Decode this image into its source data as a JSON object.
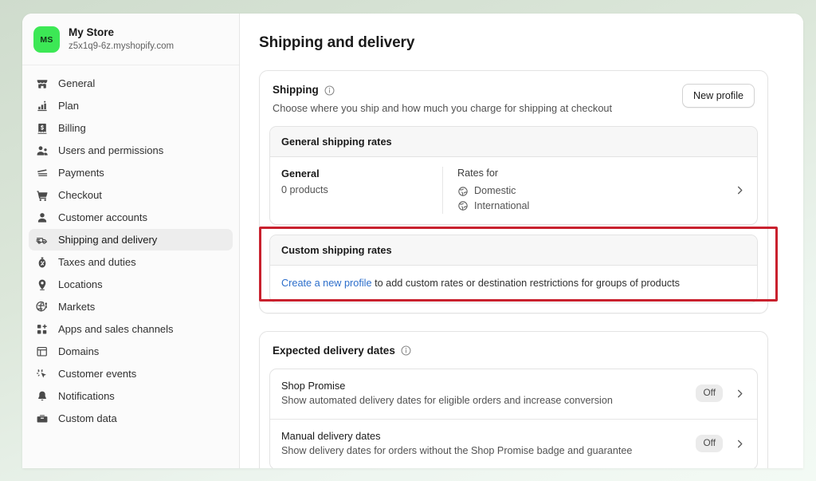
{
  "store": {
    "initials": "MS",
    "name": "My Store",
    "url": "z5x1q9-6z.myshopify.com",
    "avatar_color": "#3ce855"
  },
  "sidebar": {
    "items": [
      {
        "label": "General",
        "icon": "storefront-icon",
        "active": false
      },
      {
        "label": "Plan",
        "icon": "plan-chart-icon",
        "active": false
      },
      {
        "label": "Billing",
        "icon": "billing-receipt-icon",
        "active": false
      },
      {
        "label": "Users and permissions",
        "icon": "users-icon",
        "active": false
      },
      {
        "label": "Payments",
        "icon": "payments-card-icon",
        "active": false
      },
      {
        "label": "Checkout",
        "icon": "cart-icon",
        "active": false
      },
      {
        "label": "Customer accounts",
        "icon": "person-icon",
        "active": false
      },
      {
        "label": "Shipping and delivery",
        "icon": "delivery-truck-icon",
        "active": true
      },
      {
        "label": "Taxes and duties",
        "icon": "taxes-icon",
        "active": false
      },
      {
        "label": "Locations",
        "icon": "location-pin-icon",
        "active": false
      },
      {
        "label": "Markets",
        "icon": "globe-dollar-icon",
        "active": false
      },
      {
        "label": "Apps and sales channels",
        "icon": "apps-grid-icon",
        "active": false
      },
      {
        "label": "Domains",
        "icon": "domains-icon",
        "active": false
      },
      {
        "label": "Customer events",
        "icon": "customer-events-icon",
        "active": false
      },
      {
        "label": "Notifications",
        "icon": "bell-icon",
        "active": false
      },
      {
        "label": "Custom data",
        "icon": "custom-data-icon",
        "active": false
      }
    ]
  },
  "page": {
    "title": "Shipping and delivery"
  },
  "shipping_card": {
    "title": "Shipping",
    "info_icon": "info-circle-icon",
    "subtitle": "Choose where you ship and how much you charge for shipping at checkout",
    "new_profile_button": "New profile",
    "general_rates": {
      "heading": "General shipping rates",
      "profile_name": "General",
      "product_count": "0 products",
      "rates_label": "Rates for",
      "rates": [
        {
          "label": "Domestic",
          "icon": "globe-icon"
        },
        {
          "label": "International",
          "icon": "globe-icon"
        }
      ],
      "chevron": "chevron-right-icon"
    },
    "custom_rates": {
      "heading": "Custom shipping rates",
      "link_text": "Create a new profile",
      "body_text": " to add custom rates or destination restrictions for groups of products",
      "highlight_color": "#c9212e"
    }
  },
  "expected_delivery": {
    "title": "Expected delivery dates",
    "info_icon": "info-circle-icon",
    "rows": [
      {
        "name": "Shop Promise",
        "description": "Show automated delivery dates for eligible orders and increase conversion",
        "status": "Off",
        "chevron": "chevron-right-icon"
      },
      {
        "name": "Manual delivery dates",
        "description": "Show delivery dates for orders without the Shop Promise badge and guarantee",
        "status": "Off",
        "chevron": "chevron-right-icon"
      }
    ]
  }
}
